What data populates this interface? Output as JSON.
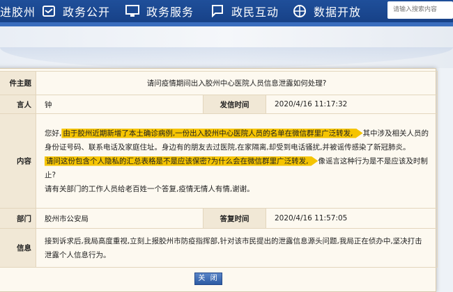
{
  "nav": {
    "home": "进胶州",
    "gov_open": "政务公开",
    "gov_service": "政务服务",
    "interaction": "政民互动",
    "data_open": "数据开放",
    "search_placeholder": "请输入搜索内容"
  },
  "dialog": {
    "topic_label": "件主题",
    "topic": "请问疫情期间出入胶州中心医院人员信息泄露如何处理?",
    "sender_label": "言人",
    "sender": "钟",
    "send_time_label": "发信时间",
    "send_time": "2020/4/16 11:17:32",
    "content_label": "内容",
    "content": {
      "p1_pre": "您好,",
      "p1_hl": "由于胶州近期新增了本土确诊病例,一份出入胶州中心医院人员的名单在微信群里广泛转发,",
      "p1_post": "其中涉及相关人员的身份证号码、联系电话及家庭住址。身边有的朋友去过医院,在家隔离,却受到电话骚扰,并被谣传感染了新冠肺炎。",
      "p2_hl": "请问这份包含个人隐私的汇总表格是不是应该保密?为什么会在微信群里广泛转发,",
      "p2_post": "像谣言这种行为是不是应该及时制止?",
      "p3": "请有关部门的工作人员给老百姓一个答复,疫情无情人有情,谢谢。"
    },
    "dept_label": "部门",
    "dept": "胶州市公安局",
    "reply_time_label": "答复时间",
    "reply_time": "2020/4/16 11:57:05",
    "reply_label": "信息",
    "reply": "接到诉求后,我局高度重视,立刻上报胶州市防疫指挥部,针对该市民提出的泄露信息源头问题,我局正在侦办中,坚决打击泄露个人信息行为。",
    "close_label": "关 闭"
  },
  "colors": {
    "nav_bg": "#1f4f9a",
    "label_text": "#1d56b0",
    "highlight": "#f5c400",
    "dialog_bg": "#fdf9f0"
  }
}
